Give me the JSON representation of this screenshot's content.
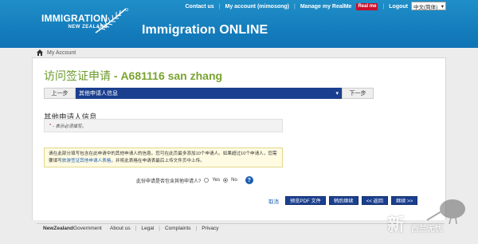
{
  "header": {
    "logo_line1": "IMMIGRATION",
    "logo_line2": "NEW ZEALAND",
    "app_title": "Immigration ONLINE",
    "links": {
      "contact": "Contact us",
      "account": "My account (mimosong)",
      "realme_label": "Manage my RealMe",
      "realme_badge": "Real me",
      "logout": "Logout"
    },
    "language": "中文(简体)"
  },
  "breadcrumb": {
    "label": "My Account"
  },
  "main": {
    "title_prefix": "访问签证申请",
    "title_suffix": " - A681116 san zhang",
    "stepbar": {
      "prev": "上一步",
      "current": "其他申请人信息",
      "next": "下一步"
    },
    "section_title": "其他申请人信息",
    "required_note": "- 表示必须填写。",
    "info_text_1": "请在此部分填写包含在此申请中的其他申请人的信息。您可在此页最多添加10个申请人。如果超过10个申请人，您需要填写",
    "info_link": "旅游签证其他申请人表格",
    "info_text_2": "，并将此表格在申请表最后上传文件页中上传。",
    "question": "此份申请是否包含其他申请人?",
    "yes_label": "Yes",
    "no_label": "No",
    "selected_answer": "No",
    "actions": {
      "cancel": "取消",
      "preview": "预览PDF 文件",
      "save_continue": "稍后继续",
      "back": "<< 返回",
      "next": "继续 >>"
    }
  },
  "footer": {
    "gov_logo_bold": "NewZealand",
    "gov_logo_rest": "Government",
    "links": [
      "About us",
      "Legal",
      "Complaints",
      "Privacy"
    ]
  },
  "watermark": {
    "text1": "新",
    "text2": "西兰无忧"
  }
}
